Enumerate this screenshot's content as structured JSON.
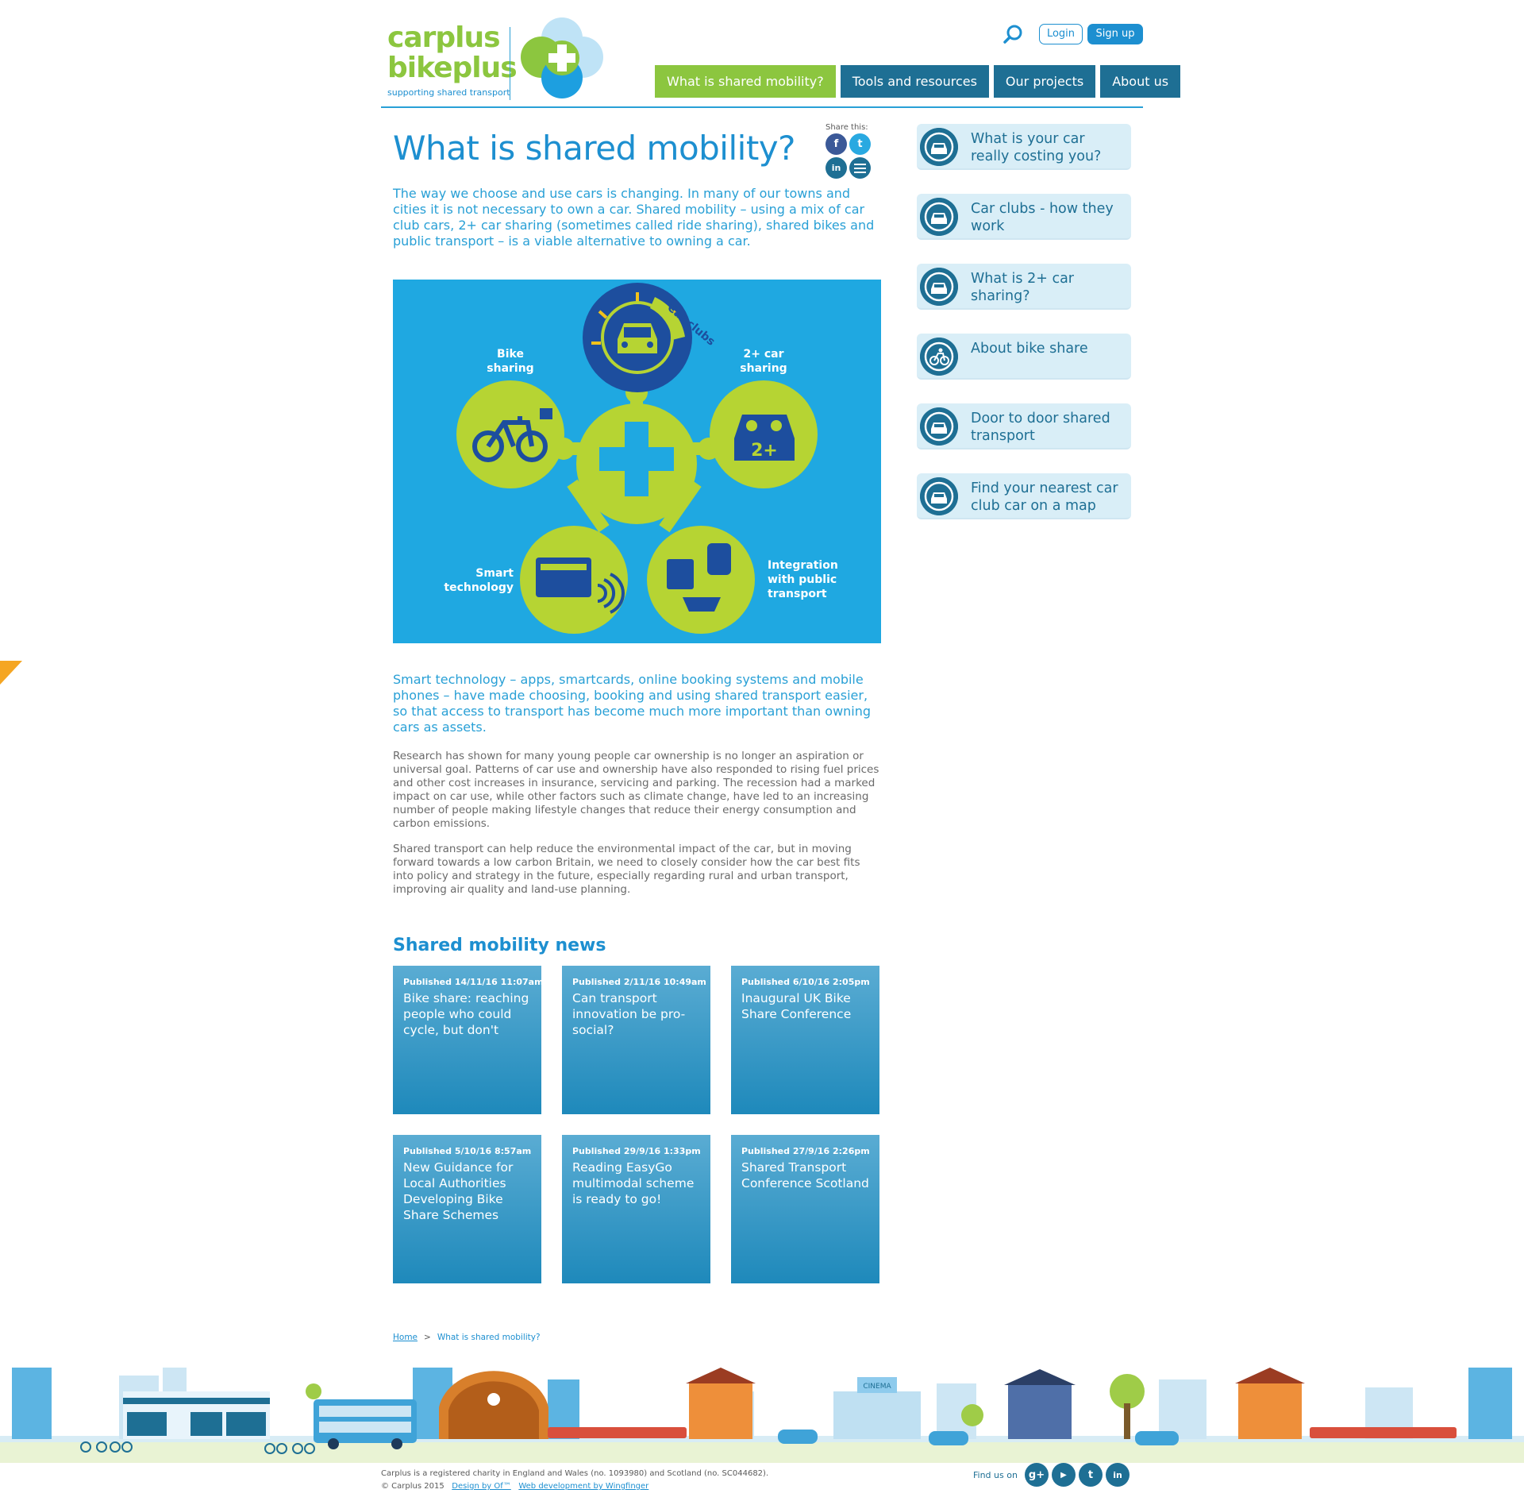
{
  "header": {
    "logo": {
      "line1": "carplus",
      "line2": "bikeplus",
      "tagline": "supporting shared transport"
    },
    "login_label": "Login",
    "signup_label": "Sign up",
    "nav": [
      {
        "label": "What is shared mobility?",
        "active": true
      },
      {
        "label": "Tools and resources"
      },
      {
        "label": "Our projects"
      },
      {
        "label": "About us"
      }
    ]
  },
  "main": {
    "title": "What is shared mobility?",
    "share_label": "Share this:",
    "intro": "The way we choose and use cars is changing. In many of our towns and cities it is not necessary to own a car. Shared mobility – using a mix of car club cars, 2+ car sharing (sometimes called ride sharing), shared bikes and public transport – is a viable alternative to owning a car.",
    "diagram": {
      "car_clubs": "Car clubs",
      "bike": [
        "Bike",
        "sharing"
      ],
      "car2": [
        "2+ car",
        "sharing"
      ],
      "smart": [
        "Smart",
        "technology"
      ],
      "integration": [
        "Integration",
        "with public",
        "transport"
      ],
      "badge": "2+"
    },
    "lead": "Smart technology – apps, smartcards, online booking systems and mobile phones – have made choosing, booking and using shared transport easier, so that access to transport has become much more important than owning cars as assets.",
    "para1": "Research has shown for many young people car ownership is no longer an aspiration or universal goal. Patterns of car use and ownership have also responded to rising fuel prices and other cost increases in insurance, servicing and parking. The recession had a marked impact on car use, while other factors such as climate change, have led to an increasing number of people making lifestyle changes that reduce their energy consumption and carbon emissions.",
    "para2": "Shared transport can help reduce the environmental impact of the car, but in moving forward towards a low carbon Britain, we need to closely consider how the car best fits into policy and strategy in the future, especially regarding rural and urban transport, improving air quality and land-use planning.",
    "news_heading": "Shared mobility news",
    "news": [
      {
        "date": "Published 14/11/16  11:07am",
        "title": "Bike share: reaching people who could cycle, but don't"
      },
      {
        "date": "Published 2/11/16  10:49am",
        "title": "Can transport innovation be pro-social?"
      },
      {
        "date": "Published 6/10/16  2:05pm",
        "title": "Inaugural UK Bike Share Conference"
      },
      {
        "date": "Published 5/10/16  8:57am",
        "title": "New Guidance for Local Authorities Developing Bike Share Schemes"
      },
      {
        "date": "Published 29/9/16  1:33pm",
        "title": "Reading EasyGo multimodal scheme is ready to go!"
      },
      {
        "date": "Published 27/9/16  2:26pm",
        "title": "Shared Transport Conference Scotland"
      }
    ],
    "breadcrumb": {
      "home": "Home",
      "sep": ">",
      "current": "What is shared mobility?"
    }
  },
  "sidebar": [
    {
      "label": "What is your car really costing you?",
      "icon": "car-icon"
    },
    {
      "label": "Car clubs - how they work",
      "icon": "car-icon"
    },
    {
      "label": "What is 2+ car sharing?",
      "icon": "car-icon"
    },
    {
      "label": "About bike share",
      "icon": "bike-icon"
    },
    {
      "label": "Door to door shared transport",
      "icon": "car-icon"
    },
    {
      "label": "Find your nearest car club car on a map",
      "icon": "car-icon"
    }
  ],
  "footer": {
    "charity": "Carplus is a registered charity in England and Wales (no. 1093980) and Scotland (no. SC044682).",
    "copyright": "© Carplus 2015",
    "design": "Design by Of™",
    "webdev": "Web development by Wingfinger",
    "find_us": "Find us on",
    "social": [
      "g+",
      "▶",
      "t",
      "in"
    ],
    "cinema": "CINEMA"
  },
  "colors": {
    "brand_blue": "#1d8fd0",
    "brand_green": "#8cc63f",
    "nav_dark": "#1e6f94"
  }
}
